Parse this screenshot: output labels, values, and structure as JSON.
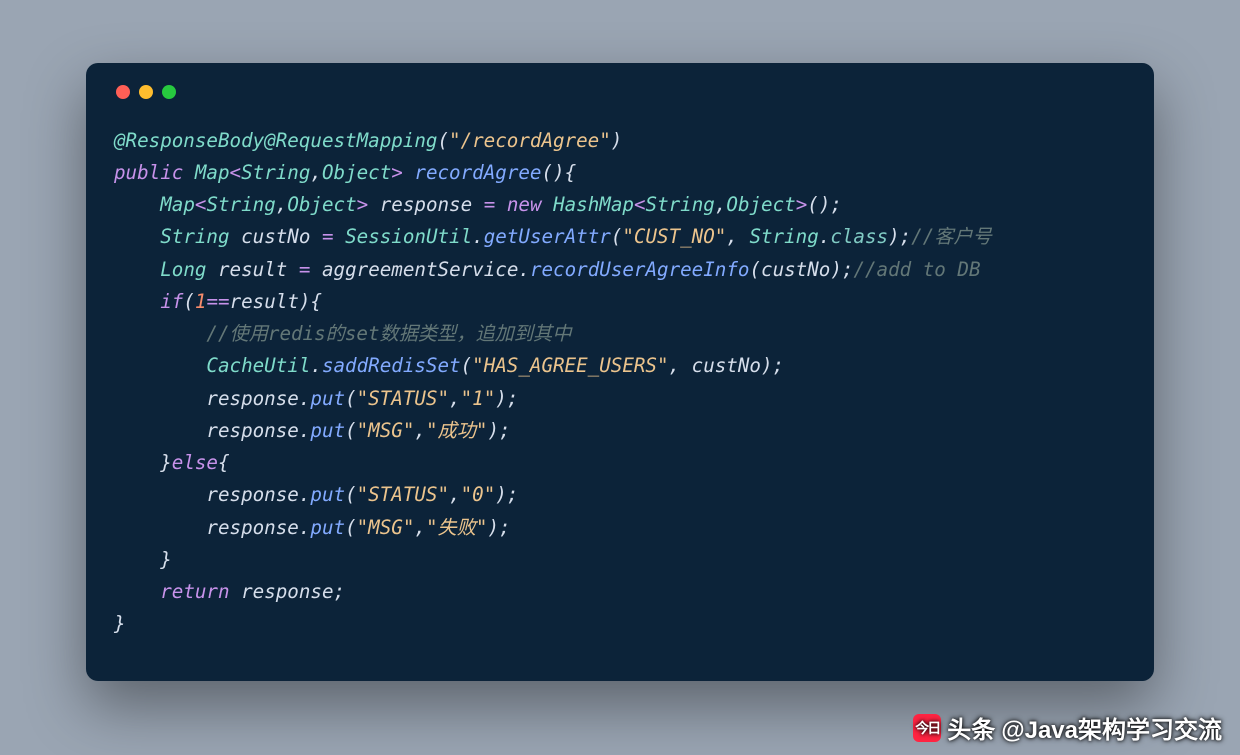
{
  "window": {
    "traffic_colors": {
      "red": "#ff5f56",
      "yellow": "#ffbd2e",
      "green": "#27c93f"
    }
  },
  "code": {
    "ann1": "@ResponseBody",
    "ann2": "@RequestMapping",
    "mapStr": "\"/recordAgree\"",
    "kw_public": "public",
    "t_map": "Map",
    "gen_String": "String",
    "gen_Object": "Object",
    "fn_recordAgree": "recordAgree",
    "v_response": "response",
    "kw_new": "new",
    "t_HashMap": "HashMap",
    "t_String": "String",
    "v_custNo": "custNo",
    "t_SessionUtil": "SessionUtil",
    "m_getUserAttr": "getUserAttr",
    "s_CUST_NO": "\"CUST_NO\"",
    "p_class": "class",
    "c_custNo": "//客户号",
    "t_Long": "Long",
    "v_result": "result",
    "v_aggreementService": "aggreementService",
    "m_recordUserAgreeInfo": "recordUserAgreeInfo",
    "c_addDB": "//add to DB",
    "kw_if": "if",
    "n_1": "1",
    "c_redis": "//使用redis的set数据类型，追加到其中",
    "t_CacheUtil": "CacheUtil",
    "m_saddRedisSet": "saddRedisSet",
    "s_HAS_AGREE_USERS": "\"HAS_AGREE_USERS\"",
    "m_put": "put",
    "s_STATUS": "\"STATUS\"",
    "s_1": "\"1\"",
    "s_MSG": "\"MSG\"",
    "s_success": "\"成功\"",
    "kw_else": "else",
    "s_0": "\"0\"",
    "s_fail": "\"失败\"",
    "kw_return": "return"
  },
  "watermark": {
    "prefix": "头条",
    "handle": "@Java架构学习交流"
  }
}
